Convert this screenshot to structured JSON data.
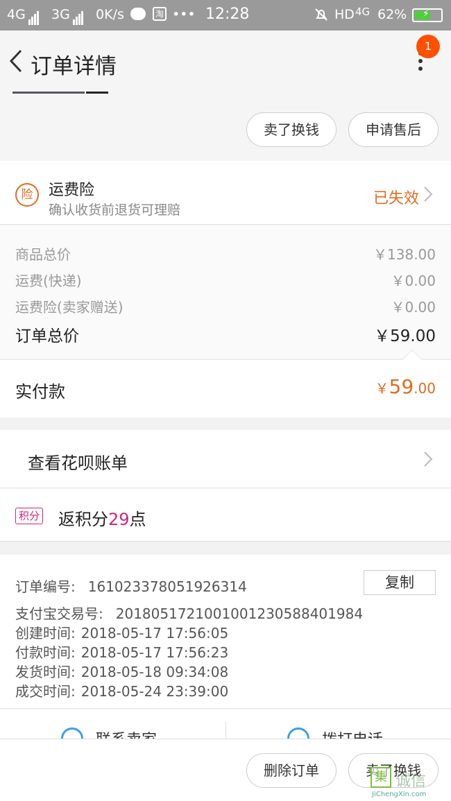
{
  "status_bar": {
    "network1": "4G",
    "network2": "3G",
    "speed": "0K/s",
    "taobao_glyph": "淘",
    "dots": "•••",
    "time": "12:28",
    "hd": "HD",
    "network3": "4G",
    "battery": "62%",
    "battery_level": 0.62
  },
  "nav": {
    "title": "订单详情",
    "badge": "1"
  },
  "top_actions": {
    "sell_button": "卖了换钱",
    "after_sale_button": "申请售后"
  },
  "insurance": {
    "icon_text": "险",
    "title": "运费险",
    "subtitle": "确认收货前退货可理赔",
    "status": "已失效"
  },
  "prices": [
    {
      "label": "商品总价",
      "value": "￥138.00"
    },
    {
      "label": "运费(快递)",
      "value": "￥0.00"
    },
    {
      "label": "运费险(卖家赠送)",
      "value": "￥0.00"
    },
    {
      "label": "订单总价",
      "value": "￥59.00"
    }
  ],
  "paid": {
    "label": "实付款",
    "currency": "￥",
    "integer": "59",
    "decimal": ".00"
  },
  "huabei": {
    "label": "查看花呗账单"
  },
  "points": {
    "tag": "积分",
    "prefix": "返积分",
    "number": "29",
    "suffix": "点"
  },
  "order_info": {
    "copy_button": "复制",
    "rows": [
      {
        "label": "订单编号:",
        "value": "161023378051926314"
      },
      {
        "label": "支付宝交易号:",
        "value": "2018051721001001230588401984"
      },
      {
        "label": "创建时间:",
        "value": "2018-05-17 17:56:05"
      },
      {
        "label": "付款时间:",
        "value": "2018-05-17 17:56:23"
      },
      {
        "label": "发货时间:",
        "value": "2018-05-18 09:34:08"
      },
      {
        "label": "成交时间:",
        "value": "2018-05-24 23:39:00"
      }
    ]
  },
  "contact": {
    "seller": "联系卖家",
    "phone": "拨打电话"
  },
  "bottom_bar": {
    "delete_button": "删除订单",
    "sell_button": "卖了换钱"
  },
  "watermark": {
    "glyph": "集",
    "name": "诚信",
    "url": "JiChengXin.com"
  },
  "colors": {
    "accent": "#e06b1f",
    "badge": "#ff5000",
    "points": "#d4237a"
  }
}
